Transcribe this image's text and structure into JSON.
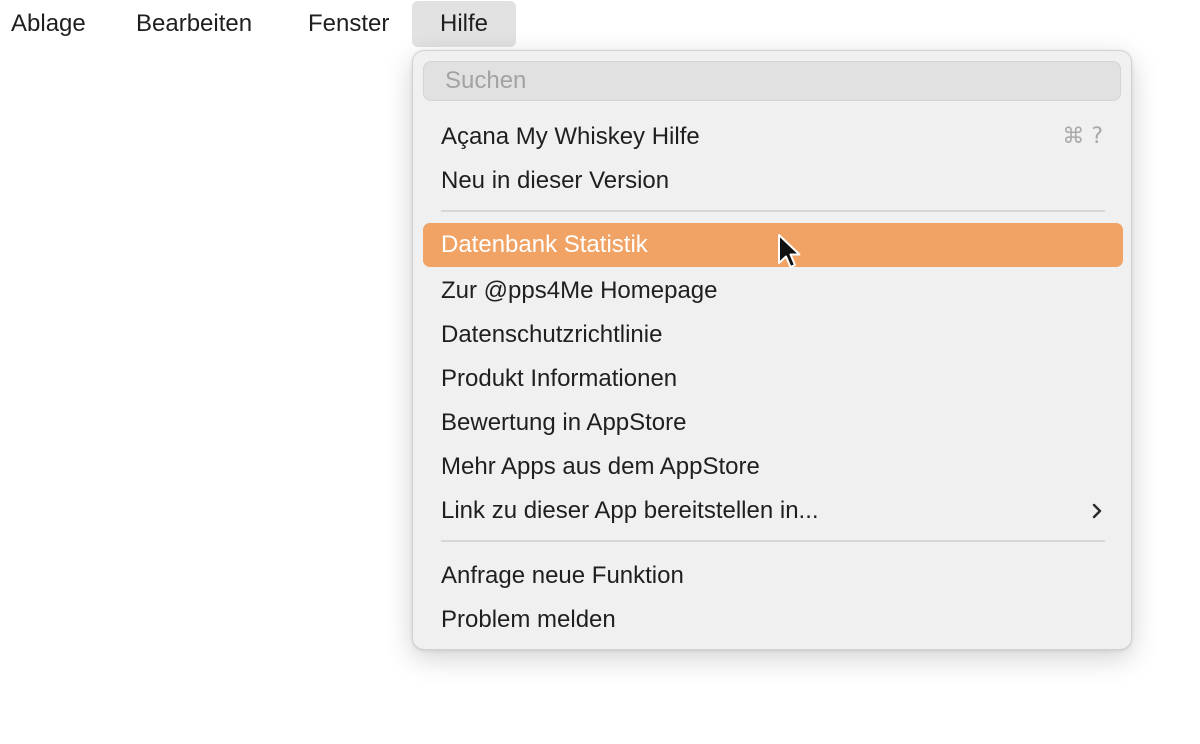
{
  "menubar": {
    "items": [
      {
        "label": "Ablage"
      },
      {
        "label": "Bearbeiten"
      },
      {
        "label": "Fenster"
      },
      {
        "label": "Hilfe",
        "active": true
      }
    ]
  },
  "help_menu": {
    "search": {
      "placeholder": "Suchen",
      "value": ""
    },
    "items": [
      {
        "label": "Açana My Whiskey Hilfe",
        "shortcut": "⌘ ?"
      },
      {
        "label": "Neu in dieser Version"
      },
      {
        "label": "Datenbank Statistik",
        "highlighted": true
      },
      {
        "label": "Zur @pps4Me Homepage"
      },
      {
        "label": "Datenschutzrichtlinie"
      },
      {
        "label": "Produkt Informationen"
      },
      {
        "label": "Bewertung in AppStore"
      },
      {
        "label": "Mehr Apps aus dem AppStore"
      },
      {
        "label": "Link zu dieser App bereitstellen in...",
        "submenu": true
      },
      {
        "label": "Anfrage neue Funktion"
      },
      {
        "label": "Problem melden"
      }
    ]
  },
  "colors": {
    "highlight": "#f0a365",
    "menu_background": "#f0f0f0"
  }
}
